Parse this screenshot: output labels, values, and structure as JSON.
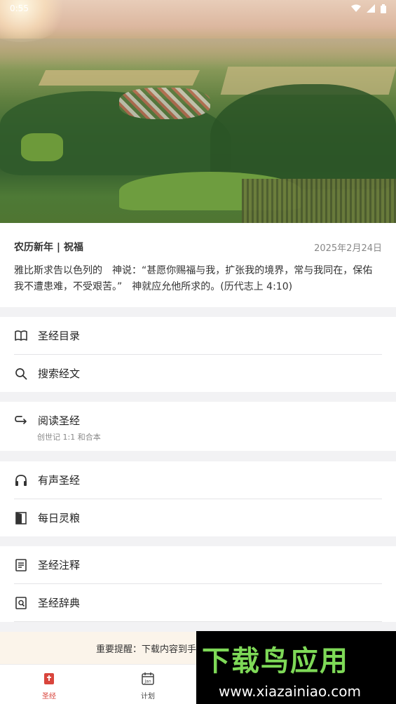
{
  "status_bar": {
    "time": "0:55"
  },
  "devotion": {
    "title": "农历新年 | 祝福",
    "date": "2025年2月24日",
    "text": "雅比斯求告以色列的　神说：“甚愿你赐福与我，扩张我的境界，常与我同在，保佑我不遭患难，不受艰苦。”　神就应允他所求的。(历代志上 4:10)"
  },
  "menu": {
    "group1": [
      {
        "label": "圣经目录",
        "icon": "open-book-icon"
      },
      {
        "label": "搜索经文",
        "icon": "search-icon"
      }
    ],
    "group2": [
      {
        "label": "阅读圣经",
        "sub": "创世记 1:1 和合本",
        "icon": "return-arrow-icon"
      }
    ],
    "group3": [
      {
        "label": "有声圣经",
        "icon": "headphones-icon"
      },
      {
        "label": "每日灵粮",
        "icon": "door-book-icon"
      }
    ],
    "group4": [
      {
        "label": "圣经注释",
        "icon": "document-icon"
      },
      {
        "label": "圣经辞典",
        "icon": "dictionary-search-icon"
      }
    ]
  },
  "notice": {
    "text": "重要提醒：下载内容到手"
  },
  "tabs": [
    {
      "label": "圣经",
      "active": true,
      "icon": "bible-icon"
    },
    {
      "label": "计划",
      "active": false,
      "icon": "calendar-icon",
      "icon_text": "Jan"
    }
  ],
  "watermark": {
    "title": "下载鸟应用",
    "url": "www.xiazainiao.com"
  },
  "colors": {
    "accent": "#d9453c",
    "notice_bg": "#fbf4ea",
    "watermark_green": "#7ed957"
  }
}
